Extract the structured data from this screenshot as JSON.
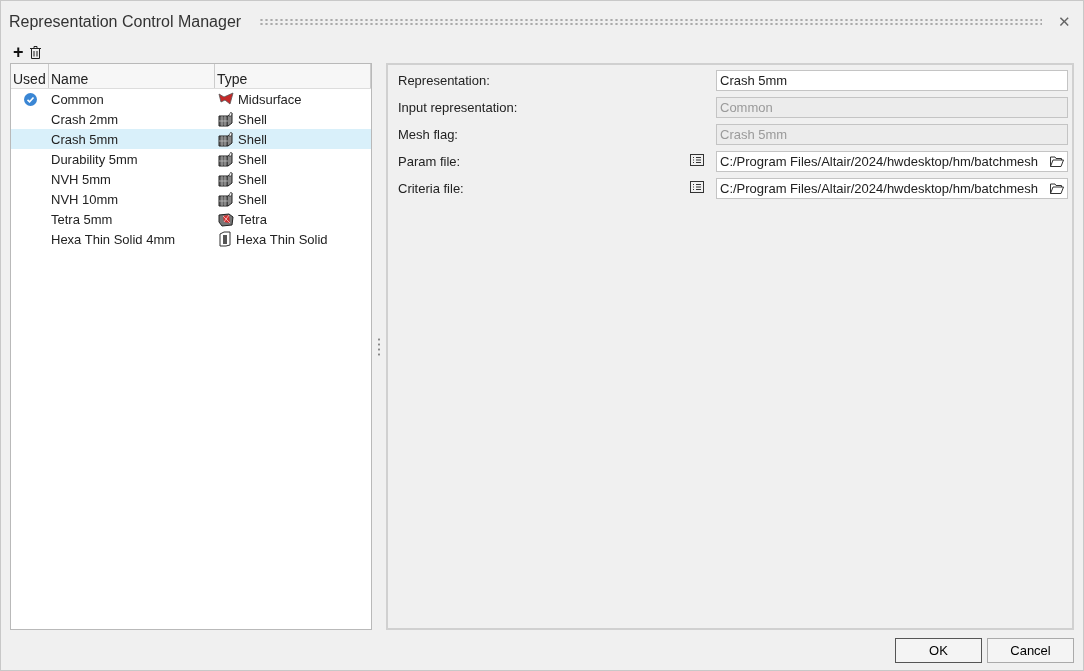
{
  "window": {
    "title": "Representation Control Manager",
    "close": "✕"
  },
  "toolbar": {
    "add": "+"
  },
  "table": {
    "columns": [
      "Used",
      "Name",
      "Type"
    ],
    "rows": [
      {
        "used": true,
        "selected": false,
        "name": "Common",
        "type": "Midsurface",
        "kind": "midsurface"
      },
      {
        "used": false,
        "selected": false,
        "name": "Crash 2mm",
        "type": "Shell",
        "kind": "shell"
      },
      {
        "used": false,
        "selected": true,
        "name": "Crash 5mm",
        "type": "Shell",
        "kind": "shell"
      },
      {
        "used": false,
        "selected": false,
        "name": "Durability 5mm",
        "type": "Shell",
        "kind": "shell"
      },
      {
        "used": false,
        "selected": false,
        "name": "NVH 5mm",
        "type": "Shell",
        "kind": "shell"
      },
      {
        "used": false,
        "selected": false,
        "name": "NVH 10mm",
        "type": "Shell",
        "kind": "shell"
      },
      {
        "used": false,
        "selected": false,
        "name": "Tetra 5mm",
        "type": "Tetra",
        "kind": "tetra"
      },
      {
        "used": false,
        "selected": false,
        "name": "Hexa Thin Solid 4mm",
        "type": "Hexa Thin Solid",
        "kind": "hexa"
      }
    ]
  },
  "properties": [
    {
      "label": "Representation:",
      "value": "Crash 5mm",
      "kind": "text",
      "disabled": false
    },
    {
      "label": "Input representation:",
      "value": "Common",
      "kind": "text",
      "disabled": true
    },
    {
      "label": "Mesh flag:",
      "value": "Crash 5mm",
      "kind": "text",
      "disabled": true
    },
    {
      "label": "Param file:",
      "value": "C:/Program Files/Altair/2024/hwdesktop/hm/batchmesh",
      "kind": "file",
      "disabled": false
    },
    {
      "label": "Criteria file:",
      "value": "C:/Program Files/Altair/2024/hwdesktop/hm/batchmesh",
      "kind": "file",
      "disabled": false
    }
  ],
  "buttons": [
    "OK",
    "Cancel"
  ]
}
